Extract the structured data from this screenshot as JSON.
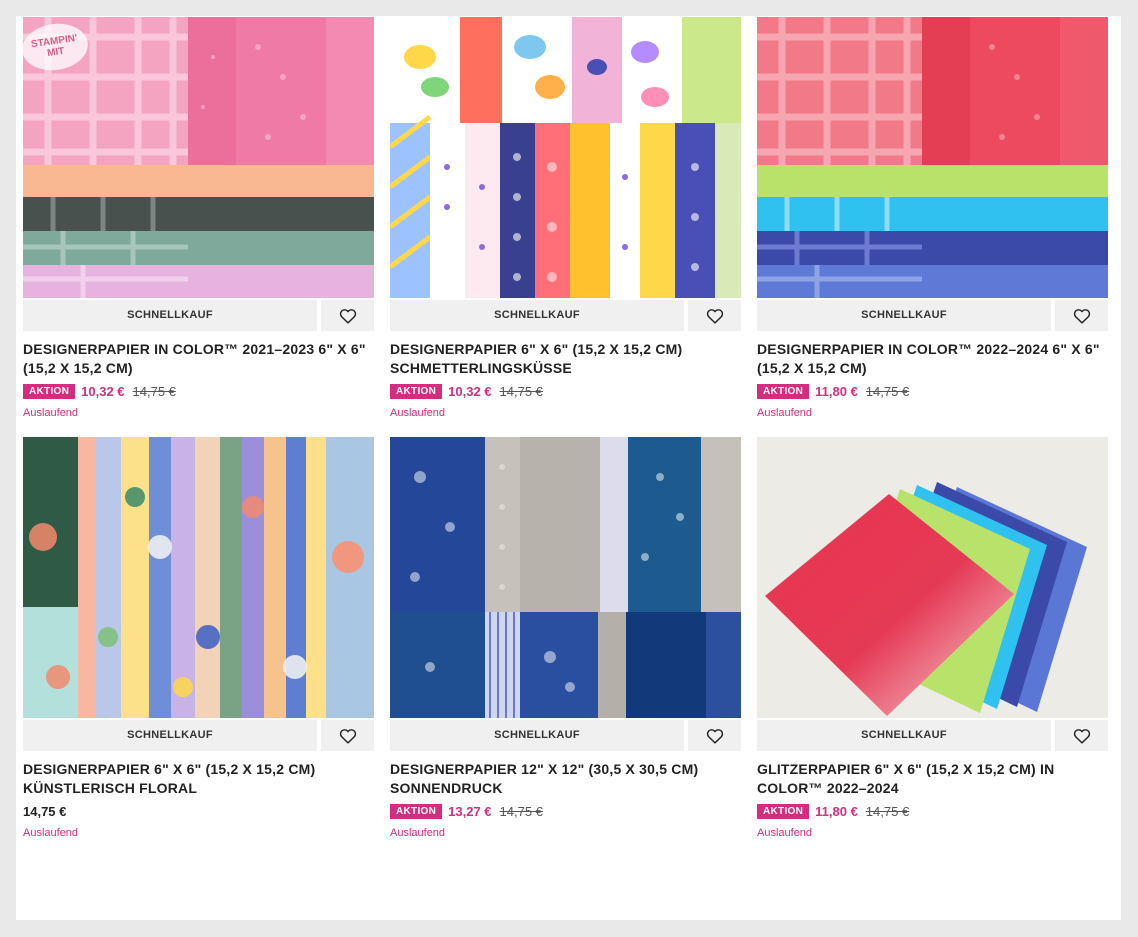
{
  "watermark": "STAMPIN' MIT",
  "products": [
    {
      "title": "DESIGNERPAPIER IN COLOR™ 2021–2023 6\" X 6\" (15,2 X 15,2 CM)",
      "quick_label": "SCHNELLKAUF",
      "badge": "AKTION",
      "sale_price": "10,32 €",
      "old_price": "14,75 €",
      "status": "Auslaufend",
      "image": "designer-paper-pink-peach-green-plaid"
    },
    {
      "title": "DESIGNERPAPIER 6\" X 6\" (15,2 X 15,2 CM) SCHMETTERLINGSKÜSSE",
      "quick_label": "SCHNELLKAUF",
      "badge": "AKTION",
      "sale_price": "10,32 €",
      "old_price": "14,75 €",
      "status": "Auslaufend",
      "image": "designer-paper-butterfly-pattern"
    },
    {
      "title": "DESIGNERPAPIER IN COLOR™ 2022–2024 6\" X 6\" (15,2 X 15,2 CM)",
      "quick_label": "SCHNELLKAUF",
      "badge": "AKTION",
      "sale_price": "11,80 €",
      "old_price": "14,75 €",
      "status": "Auslaufend",
      "image": "designer-paper-red-green-blue-plaid"
    },
    {
      "title": "DESIGNERPAPIER 6\" X 6\" (15,2 X 15,2 CM) KÜNSTLERISCH FLORAL",
      "quick_label": "SCHNELLKAUF",
      "price": "14,75 €",
      "status": "Auslaufend",
      "image": "designer-paper-painted-floral"
    },
    {
      "title": "DESIGNERPAPIER 12\" X 12\" (30,5 X 30,5 CM) SONNENDRUCK",
      "quick_label": "SCHNELLKAUF",
      "badge": "AKTION",
      "sale_price": "13,27 €",
      "old_price": "14,75 €",
      "status": "Auslaufend",
      "image": "designer-paper-blue-sunprint"
    },
    {
      "title": "GLITZERPAPIER 6\" X 6\" (15,2 X 15,2 CM) IN COLOR™ 2022–2024",
      "quick_label": "SCHNELLKAUF",
      "badge": "AKTION",
      "sale_price": "11,80 €",
      "old_price": "14,75 €",
      "status": "Auslaufend",
      "image": "glitter-paper-fanned-stack"
    }
  ],
  "colors": {
    "accent": "#d42d7f",
    "button_bg": "#f0f0f0",
    "frame": "#e9e9e9"
  },
  "icons": {
    "favorite": "heart-outline-icon"
  }
}
